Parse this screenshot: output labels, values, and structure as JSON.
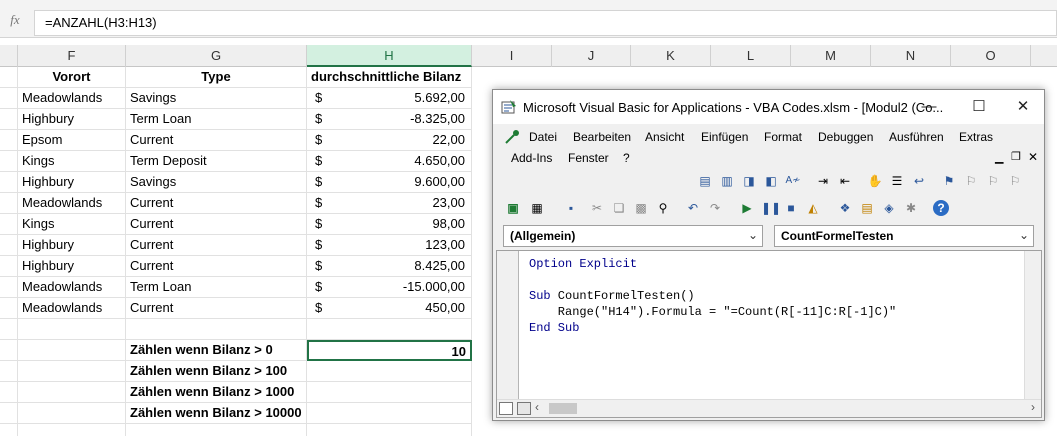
{
  "formula_bar": {
    "fx_label": "fx",
    "formula": "=ANZAHL(H3:H13)"
  },
  "columns": [
    "F",
    "G",
    "H",
    "I",
    "J",
    "K",
    "L",
    "M",
    "N",
    "O"
  ],
  "selected_column": "H",
  "headers": {
    "vorort": "Vorort",
    "type": "Type",
    "bilanz": "durchschnittliche Bilanz"
  },
  "currency_symbol": "$",
  "rows": [
    {
      "vorort": "Meadowlands",
      "type": "Savings",
      "amount": "5.692,00"
    },
    {
      "vorort": "Highbury",
      "type": "Term Loan",
      "amount": "-8.325,00"
    },
    {
      "vorort": "Epsom",
      "type": "Current",
      "amount": "22,00"
    },
    {
      "vorort": "Kings",
      "type": "Term Deposit",
      "amount": "4.650,00"
    },
    {
      "vorort": "Highbury",
      "type": "Savings",
      "amount": "9.600,00"
    },
    {
      "vorort": "Meadowlands",
      "type": "Current",
      "amount": "23,00"
    },
    {
      "vorort": "Kings",
      "type": "Current",
      "amount": "98,00"
    },
    {
      "vorort": "Highbury",
      "type": "Current",
      "amount": "123,00"
    },
    {
      "vorort": "Highbury",
      "type": "Current",
      "amount": "8.425,00"
    },
    {
      "vorort": "Meadowlands",
      "type": "Term Loan",
      "amount": "-15.000,00"
    },
    {
      "vorort": "Meadowlands",
      "type": "Current",
      "amount": "450,00"
    }
  ],
  "summary": [
    {
      "label": "Zählen wenn Bilanz > 0",
      "value": "10"
    },
    {
      "label": "Zählen wenn Bilanz > 100",
      "value": ""
    },
    {
      "label": "Zählen wenn Bilanz > 1000",
      "value": ""
    },
    {
      "label": "Zählen wenn Bilanz > 10000",
      "value": ""
    }
  ],
  "vba": {
    "title": "Microsoft Visual Basic for Applications - VBA Codes.xlsm - [Modul2 (Co...",
    "minimize": "—",
    "maximize": "☐",
    "close": "✕",
    "menu": {
      "datei": "Datei",
      "bearbeiten": "Bearbeiten",
      "ansicht": "Ansicht",
      "einfuegen": "Einfügen",
      "format": "Format",
      "debuggen": "Debuggen",
      "ausfuehren": "Ausführen",
      "extras": "Extras",
      "addins": "Add-Ins",
      "fenster": "Fenster",
      "help": "?"
    },
    "object_combo": "(Allgemein)",
    "proc_combo": "CountFormelTesten",
    "code": {
      "line1_kw": "Option Explicit",
      "line2_kw": "Sub",
      "line2_rest": " CountFormelTesten()",
      "line3": "    Range(\"H14\").Formula = \"=Count(R[-11]C:R[-1]C)\"",
      "line4_kw": "End Sub"
    }
  }
}
